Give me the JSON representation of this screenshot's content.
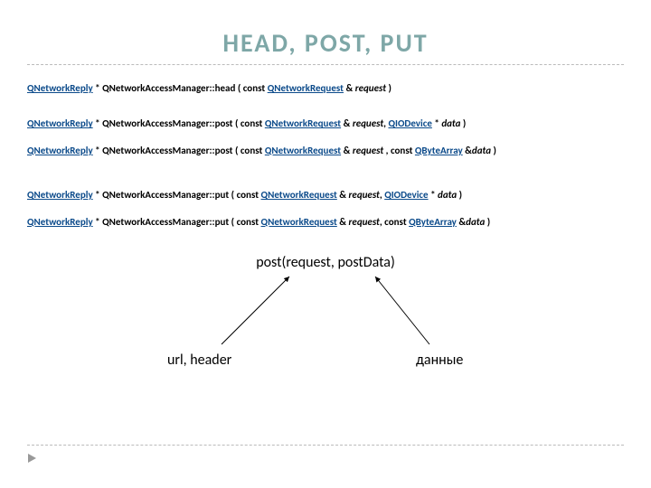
{
  "title": "HEAD, POST, PUT",
  "signatures": [
    {
      "ret": "QNetworkReply",
      "mid1": " * QNetworkAccessManager::head ( const ",
      "arg1": "QNetworkRequest",
      "mid2": " & ",
      "ital1": "request",
      "tail": " )"
    },
    {
      "ret": "QNetworkReply",
      "mid1": " * QNetworkAccessManager::post ( const ",
      "arg1": "QNetworkRequest",
      "mid2": " & ",
      "ital1": "request",
      "mid3": ", ",
      "arg2": "QIODevice",
      "mid4": " * ",
      "ital2": "data",
      "tail": " )"
    },
    {
      "ret": "QNetworkReply",
      "mid1": " * QNetworkAccessManager::post ( const ",
      "arg1": "QNetworkRequest",
      "mid2": " & ",
      "ital1": "request",
      "mid3": " , const ",
      "arg2": "QByteArray",
      "mid4": " &",
      "ital2": "data",
      "tail": " )"
    },
    {
      "ret": "QNetworkReply",
      "mid1": " * QNetworkAccessManager::put ( const ",
      "arg1": "QNetworkRequest",
      "mid2": " & ",
      "ital1": "request",
      "mid3": ", ",
      "arg2": "QIODevice",
      "mid4": " * ",
      "ital2": "data",
      "tail": " )"
    },
    {
      "ret": "QNetworkReply",
      "mid1": " * QNetworkAccessManager::put ( const ",
      "arg1": "QNetworkRequest",
      "mid2": " & ",
      "ital1": "request",
      "mid3": ", const ",
      "arg2": "QByteArray",
      "mid4": " &",
      "ital2": "data",
      "tail": " )"
    }
  ],
  "diagram": {
    "top": "post(request, postData)",
    "left": "url, header",
    "right": "данные"
  }
}
